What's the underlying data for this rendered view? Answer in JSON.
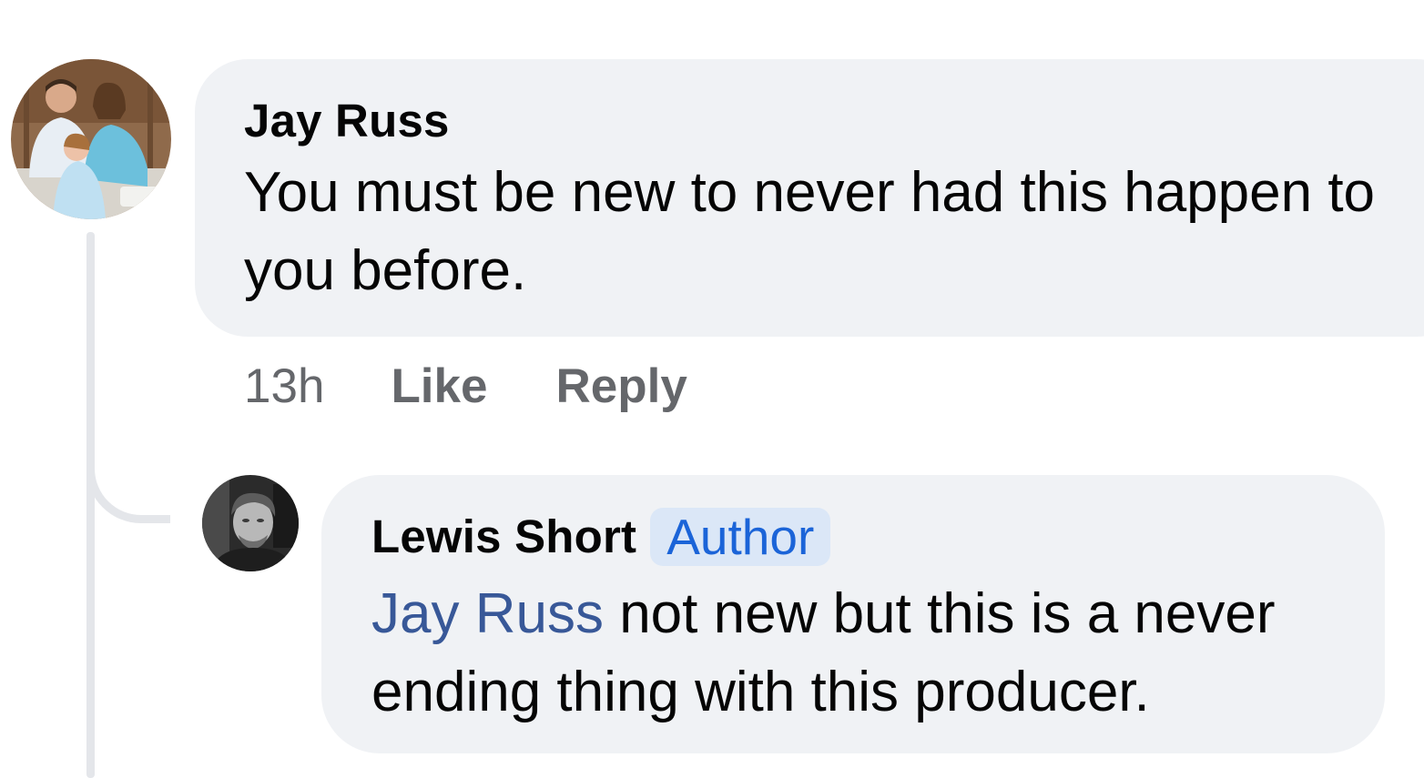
{
  "thread": {
    "comments": [
      {
        "author": "Jay Russ",
        "text": "You must be new to never had this happen to you before.",
        "time": "13h",
        "actions": [
          "Like",
          "Reply"
        ]
      },
      {
        "author": "Lewis Short",
        "badge": "Author",
        "mention": "Jay Russ",
        "text": "not new but this is a never ending thing with this producer."
      }
    ]
  },
  "colors": {
    "bubble_bg": "#f0f2f5",
    "mention": "#385898",
    "badge_bg": "#dbe7f7",
    "badge_text": "#1b64d8",
    "meta_text": "#65676b",
    "thread_line": "#e4e6ea"
  }
}
